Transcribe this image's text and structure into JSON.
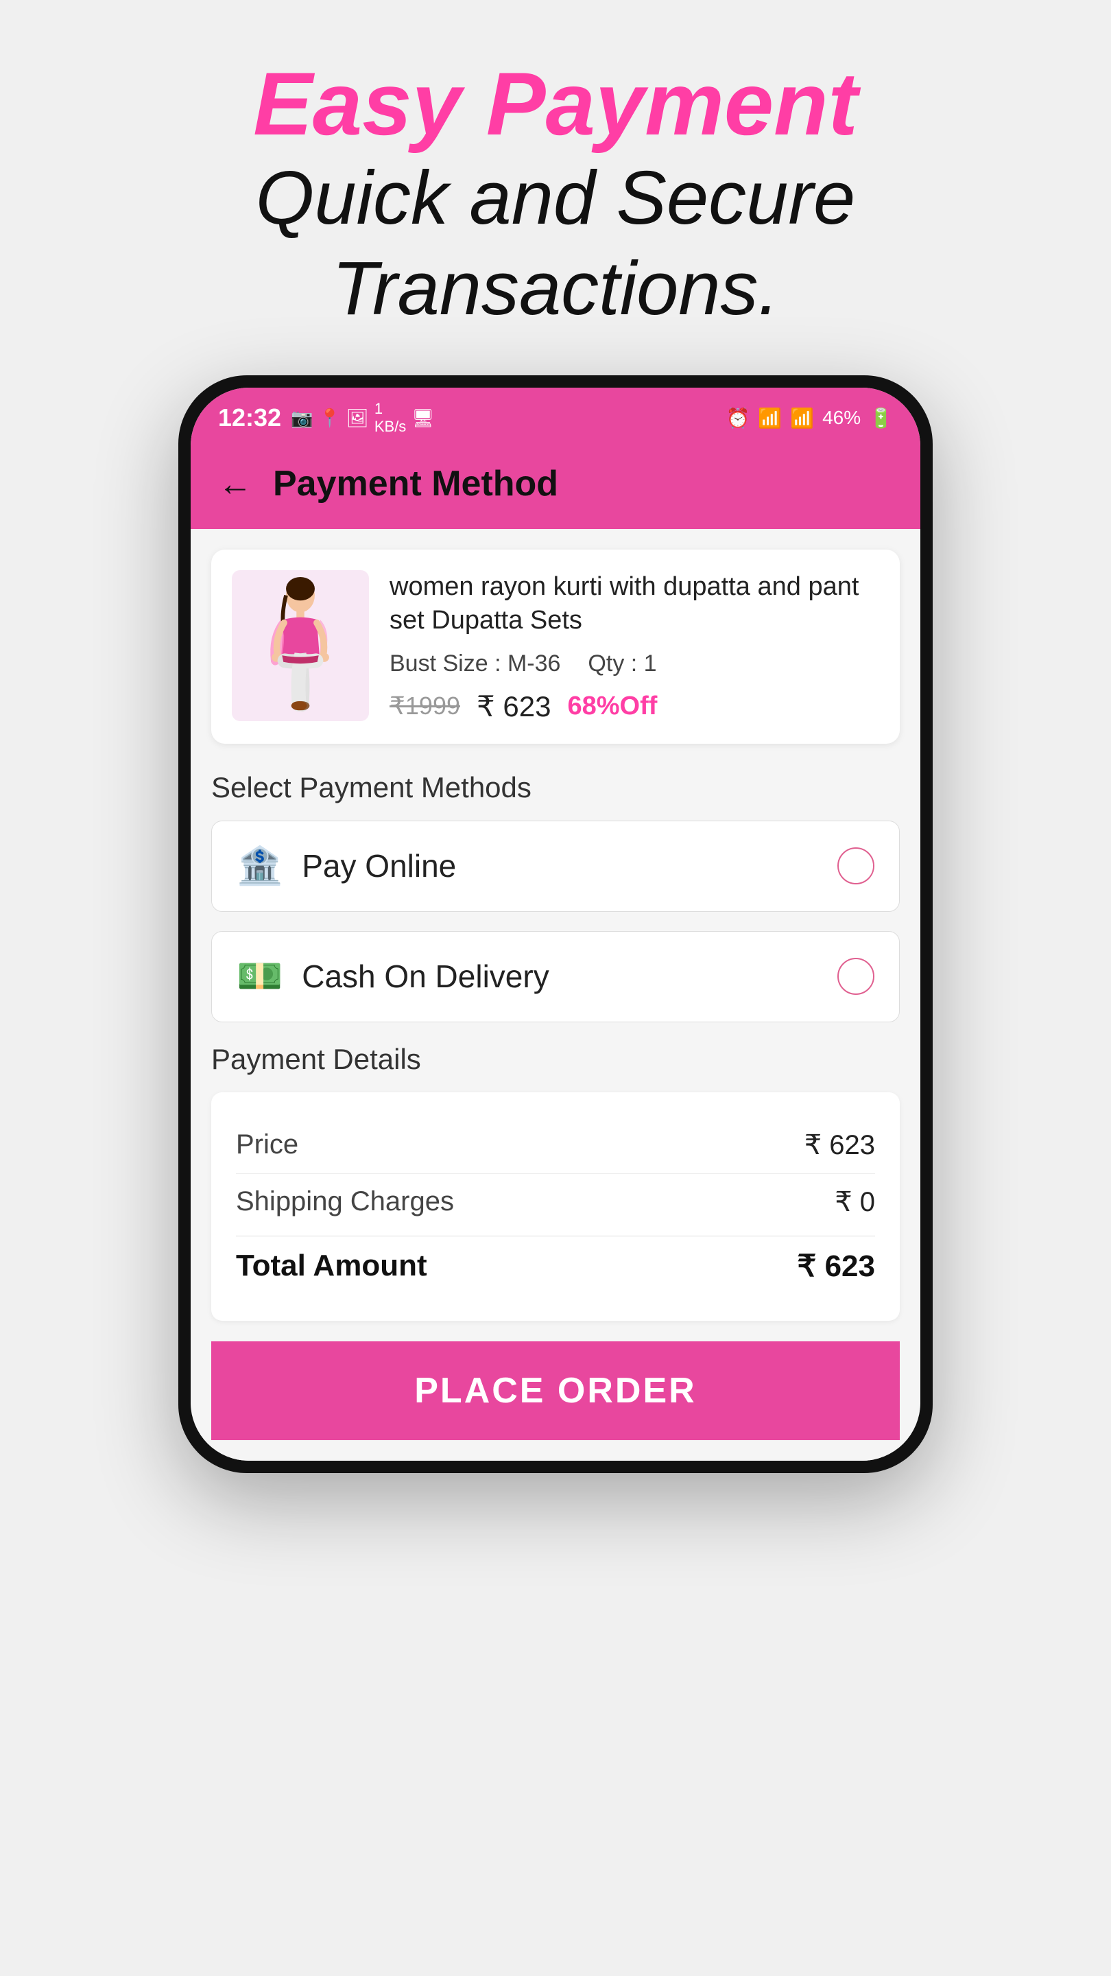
{
  "header": {
    "easy_payment": "Easy Payment",
    "subtitle_line1": "Quick and Secure",
    "subtitle_line2": "Transactions."
  },
  "status_bar": {
    "time": "12:32",
    "battery": "46%"
  },
  "app_header": {
    "title": "Payment Method",
    "back_label": "←"
  },
  "product": {
    "name": "women rayon kurti with dupatta and pant set Dupatta Sets",
    "bust_size_label": "Bust Size : M-36",
    "qty_label": "Qty : 1",
    "price_original": "₹1999",
    "price_discounted": "₹ 623",
    "discount": "68%Off"
  },
  "payment_methods": {
    "section_title": "Select Payment Methods",
    "options": [
      {
        "id": "pay-online",
        "label": "Pay Online",
        "icon": "🏦"
      },
      {
        "id": "cash-on-delivery",
        "label": "Cash On Delivery",
        "icon": "💵"
      }
    ]
  },
  "payment_details": {
    "section_title": "Payment Details",
    "rows": [
      {
        "label": "Price",
        "value": "₹ 623"
      },
      {
        "label": "Shipping Charges",
        "value": "₹ 0"
      }
    ],
    "total_label": "Total Amount",
    "total_value": "₹ 623"
  },
  "place_order_btn": "PLACE ORDER"
}
